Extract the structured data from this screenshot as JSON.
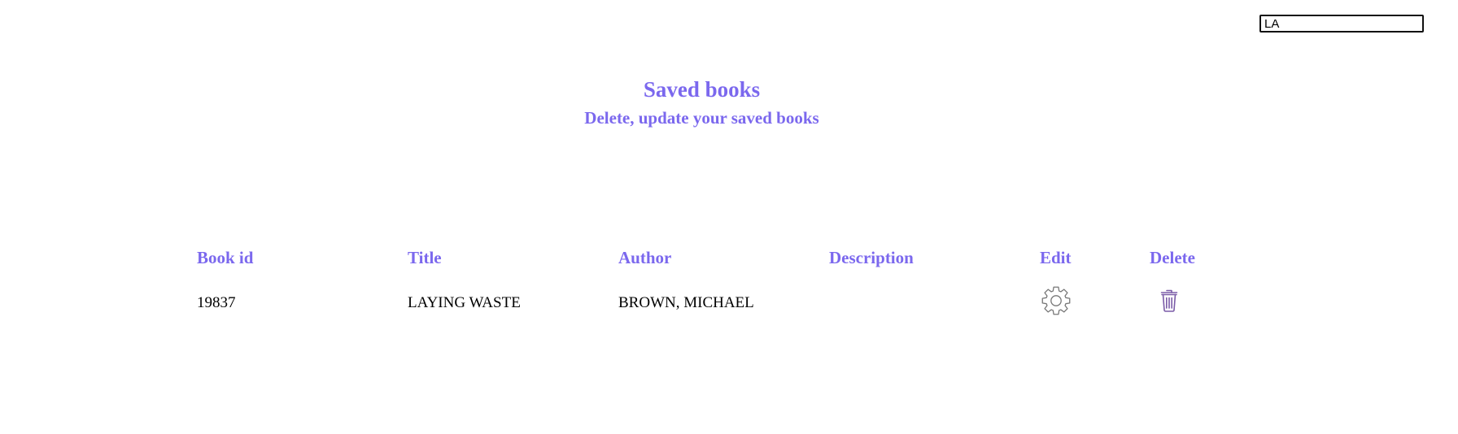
{
  "search": {
    "value": "LA",
    "placeholder": ""
  },
  "header": {
    "title": "Saved books",
    "subtitle": "Delete, update your saved books"
  },
  "table": {
    "columns": [
      "Book id",
      "Title",
      "Author",
      "Description",
      "Edit",
      "Delete"
    ],
    "rows": [
      {
        "book_id": "19837",
        "title": "LAYING WASTE",
        "author": "BROWN, MICHAEL",
        "description": "",
        "edit_icon": "gear-icon",
        "delete_icon": "trash-icon"
      }
    ]
  },
  "colors": {
    "accent": "#7b68ee",
    "gear_icon": "#777777",
    "trash_icon": "#7b5ca8"
  }
}
